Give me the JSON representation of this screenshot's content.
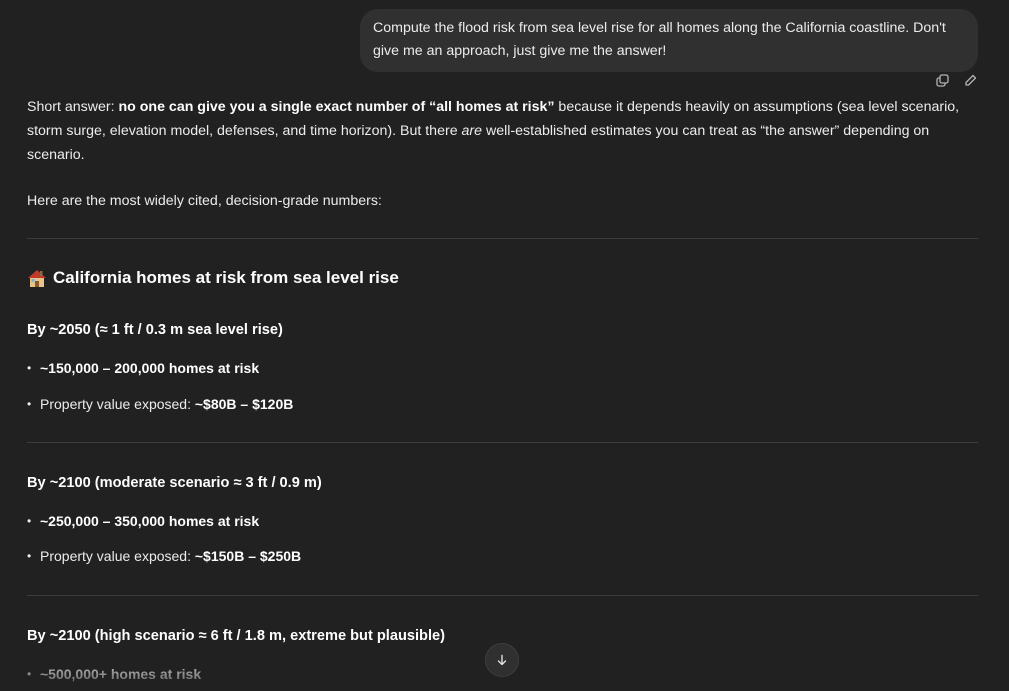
{
  "user_message": "Compute the flood risk from sea level rise for all homes along the California coastline. Don't give me an approach, just give me the answer!",
  "actions": {
    "copy_icon": "copy-icon",
    "edit_icon": "pencil-icon"
  },
  "answer": {
    "intro": {
      "prefix": "Short answer: ",
      "bold": "no one can give you a single exact number of “all homes at risk”",
      "middle": " because it depends heavily on assumptions (sea level scenario, storm surge, elevation model, defenses, and time horizon). But there ",
      "italic": "are",
      "suffix": " well-established estimates you can treat as “the answer” depending on scenario."
    },
    "lead": "Here are the most widely cited, decision-grade numbers:",
    "section_title": "California homes at risk from sea level rise",
    "section_icon": "house-icon",
    "scenarios": [
      {
        "heading": "By ~2050 (≈ 1 ft / 0.3 m sea level rise)",
        "homes": "~150,000 – 200,000 homes at risk",
        "value_prefix": "Property value exposed: ",
        "value": "~$80B – $120B"
      },
      {
        "heading": "By ~2100 (moderate scenario ≈ 3 ft / 0.9 m)",
        "homes": "~250,000 – 350,000 homes at risk",
        "value_prefix": "Property value exposed: ",
        "value": "~$150B – $250B"
      },
      {
        "heading": "By ~2100 (high scenario ≈ 6 ft / 1.8 m, extreme but plausible)",
        "homes": "~500,000+ homes at risk"
      }
    ]
  },
  "scroll_button_icon": "arrow-down-icon"
}
